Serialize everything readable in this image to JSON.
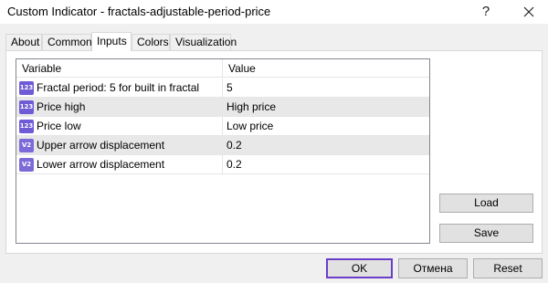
{
  "window": {
    "title": "Custom Indicator - fractals-adjustable-period-price",
    "help_label": "?",
    "close_icon": "close-icon"
  },
  "tabs": [
    {
      "label": "About"
    },
    {
      "label": "Common"
    },
    {
      "label": "Inputs",
      "active": true
    },
    {
      "label": "Colors"
    },
    {
      "label": "Visualization"
    }
  ],
  "inputs_table": {
    "columns": [
      "Variable",
      "Value"
    ],
    "rows": [
      {
        "icon": "integer-type-icon",
        "icon_text": "123",
        "variable": "Fractal period: 5 for built in fractal",
        "value": "5"
      },
      {
        "icon": "integer-type-icon",
        "icon_text": "123",
        "variable": "Price high",
        "value": "High price"
      },
      {
        "icon": "integer-type-icon",
        "icon_text": "123",
        "variable": "Price low",
        "value": "Low price"
      },
      {
        "icon": "double-type-icon",
        "icon_text": "V2",
        "variable": "Upper arrow displacement",
        "value": "0.2"
      },
      {
        "icon": "double-type-icon",
        "icon_text": "V2",
        "variable": "Lower arrow displacement",
        "value": "0.2"
      }
    ]
  },
  "side_buttons": {
    "load": "Load",
    "save": "Save"
  },
  "footer_buttons": {
    "ok": "OK",
    "cancel": "Отмена",
    "reset": "Reset"
  },
  "colors": {
    "accent": "#6a3fc7",
    "type_icon": "#6f5bd6"
  }
}
